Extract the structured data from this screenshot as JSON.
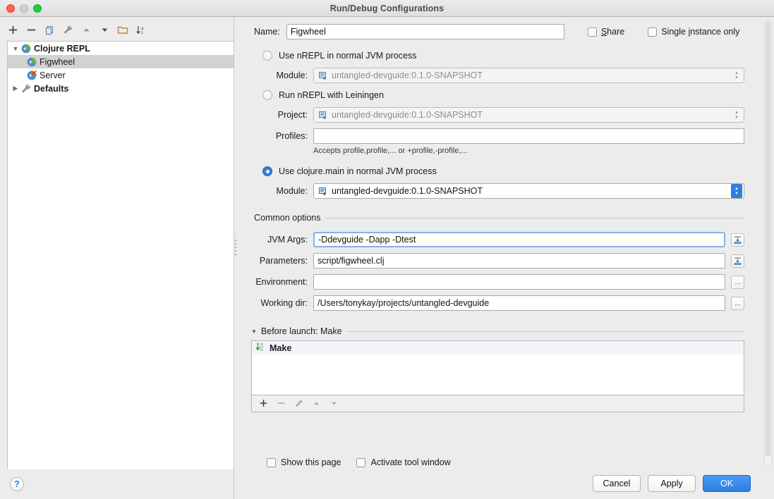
{
  "window": {
    "title": "Run/Debug Configurations",
    "traffic_lights": [
      "close-red",
      "minimize-gray",
      "zoom-green"
    ]
  },
  "sidebar": {
    "toolbar": [
      {
        "name": "add-configuration-button",
        "icon": "plus-icon",
        "label": "+"
      },
      {
        "name": "remove-configuration-button",
        "icon": "minus-icon",
        "label": "−"
      },
      {
        "name": "copy-configuration-button",
        "icon": "copy-icon",
        "label": ""
      },
      {
        "name": "edit-templates-button",
        "icon": "wrench-icon",
        "label": ""
      },
      {
        "name": "move-up-button",
        "icon": "arrow-up-icon",
        "label": ""
      },
      {
        "name": "move-down-button",
        "icon": "arrow-down-icon",
        "label": ""
      },
      {
        "name": "folder-button",
        "icon": "folder-icon",
        "label": ""
      },
      {
        "name": "sort-alphabetically-button",
        "icon": "sort-az-icon",
        "label": ""
      }
    ],
    "tree": [
      {
        "label": "Clojure REPL",
        "icon": "clojure-repl-icon",
        "level": 0,
        "expanded": true,
        "twisty": "▼",
        "selected": false,
        "bold": true
      },
      {
        "label": "Figwheel",
        "icon": "run-config-icon",
        "level": 1,
        "expanded": null,
        "twisty": "",
        "selected": true,
        "bold": false
      },
      {
        "label": "Server",
        "icon": "run-config-error-icon",
        "level": 1,
        "expanded": null,
        "twisty": "",
        "selected": false,
        "bold": false
      },
      {
        "label": "Defaults",
        "icon": "wrench-icon",
        "level": 0,
        "expanded": false,
        "twisty": "▶",
        "selected": false,
        "bold": true
      }
    ],
    "help_button": "?"
  },
  "header": {
    "name_label": "Name:",
    "name_value": "Figwheel",
    "name_placeholder": "",
    "share_label_prefix": "",
    "share_mnemonic": "S",
    "share_label_suffix": "hare",
    "share_checked": false,
    "single_instance_prefix": "Single ",
    "single_instance_mnemonic": "i",
    "single_instance_suffix": "nstance only",
    "single_instance_checked": false
  },
  "options": {
    "radios": [
      {
        "label": "Use nREPL in normal JVM process",
        "selected": false
      },
      {
        "label": "Run nREPL with Leiningen",
        "selected": false
      },
      {
        "label": "Use clojure.main in normal JVM process",
        "selected": true
      }
    ],
    "module_label_1": "Module:",
    "module_value_1": "untangled-devguide:0.1.0-SNAPSHOT",
    "module_enabled_1": false,
    "project_label": "Project:",
    "project_value": "untangled-devguide:0.1.0-SNAPSHOT",
    "project_enabled": false,
    "profiles_label": "Profiles:",
    "profiles_value": "",
    "profiles_hint": "Accepts profile,profile,... or +profile,-profile,...",
    "module_label_2": "Module:",
    "module_value_2": "untangled-devguide:0.1.0-SNAPSHOT",
    "module_enabled_2": true
  },
  "common": {
    "title": "Common options",
    "fields": [
      {
        "label": "JVM Args:",
        "value": "-Ddevguide -Dapp -Dtest",
        "focused": true,
        "button": "expand-icon"
      },
      {
        "label": "Parameters:",
        "value": "script/figwheel.clj",
        "focused": false,
        "button": "expand-icon"
      },
      {
        "label": "Environment:",
        "value": "",
        "focused": false,
        "button": "..."
      },
      {
        "label": "Working dir:",
        "value": "/Users/tonykay/projects/untangled-devguide",
        "focused": false,
        "button": "..."
      }
    ]
  },
  "before_launch": {
    "title": "Before launch: Make",
    "twisty": "▼",
    "items": [
      {
        "label": "Make",
        "icon": "make-build-icon"
      }
    ],
    "toolbar": [
      {
        "name": "add-task-button",
        "icon": "plus-icon",
        "enabled": true
      },
      {
        "name": "remove-task-button",
        "icon": "minus-icon",
        "enabled": false
      },
      {
        "name": "edit-task-button",
        "icon": "pencil-icon",
        "enabled": false
      },
      {
        "name": "move-task-up-button",
        "icon": "arrow-up-icon",
        "enabled": false
      },
      {
        "name": "move-task-down-button",
        "icon": "arrow-down-icon",
        "enabled": false
      }
    ]
  },
  "footer": {
    "show_page_label": "Show this page",
    "show_page_checked": false,
    "activate_window_label": "Activate tool window",
    "activate_window_checked": false,
    "cancel_label": "Cancel",
    "apply_label": "Apply",
    "ok_label": "OK"
  },
  "colors": {
    "accent_blue": "#2e7fe0",
    "selection_gray": "#d2d2d2",
    "window_bg": "#ececec",
    "focus_ring": "#7eb4ea",
    "make_icon_green": "#3fa33f",
    "error_red": "#d93f3f"
  }
}
